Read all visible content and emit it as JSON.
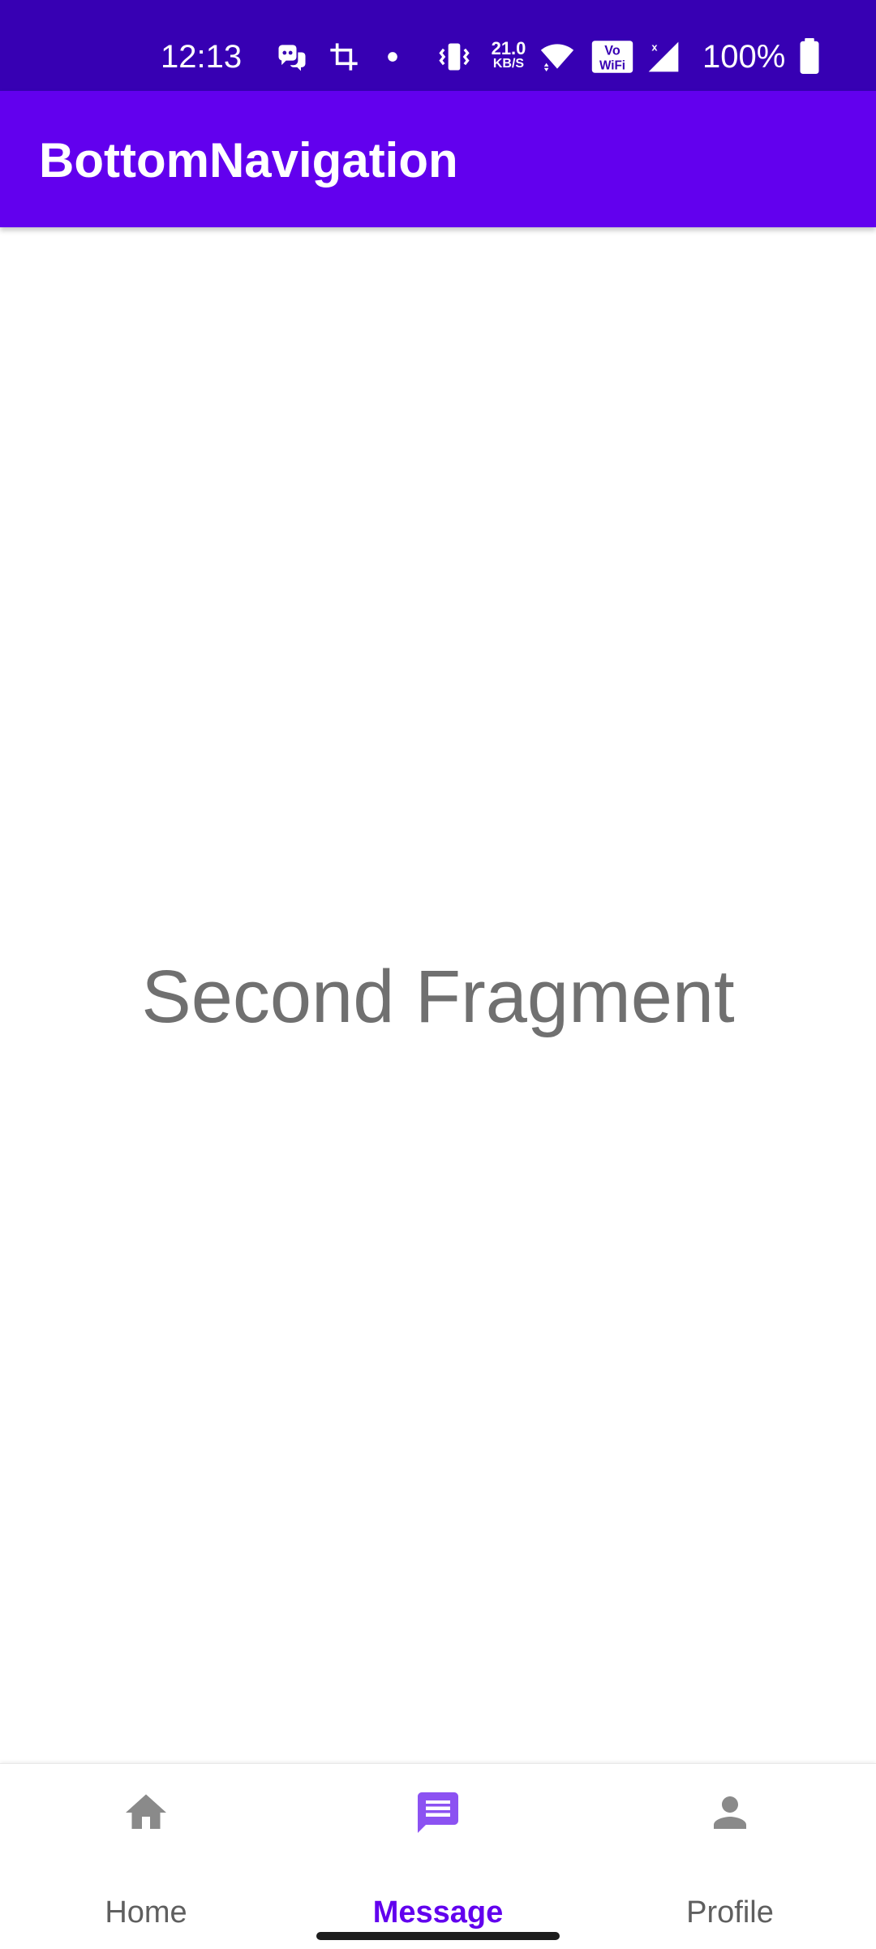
{
  "status_bar": {
    "time": "12:13",
    "net_speed_value": "21.0",
    "net_speed_unit": "KB/S",
    "battery_percent": "100%",
    "icons": [
      "discord-icon",
      "crop-icon",
      "dot-icon",
      "vibrate-icon",
      "wifi-icon",
      "vowifi-icon",
      "signal-icon",
      "battery-icon"
    ]
  },
  "app_bar": {
    "title": "BottomNavigation"
  },
  "content": {
    "fragment_text": "Second Fragment"
  },
  "bottom_nav": {
    "items": [
      {
        "label": "Home",
        "icon": "home-icon",
        "active": false
      },
      {
        "label": "Message",
        "icon": "message-icon",
        "active": true
      },
      {
        "label": "Profile",
        "icon": "person-icon",
        "active": false
      }
    ]
  },
  "colors": {
    "status_bar": "#3700B3",
    "app_bar": "#6200EE",
    "active_nav": "#6200EE",
    "active_icon": "#8C52F2",
    "inactive_nav": "#8a8a8a",
    "fragment_text": "#707070"
  }
}
